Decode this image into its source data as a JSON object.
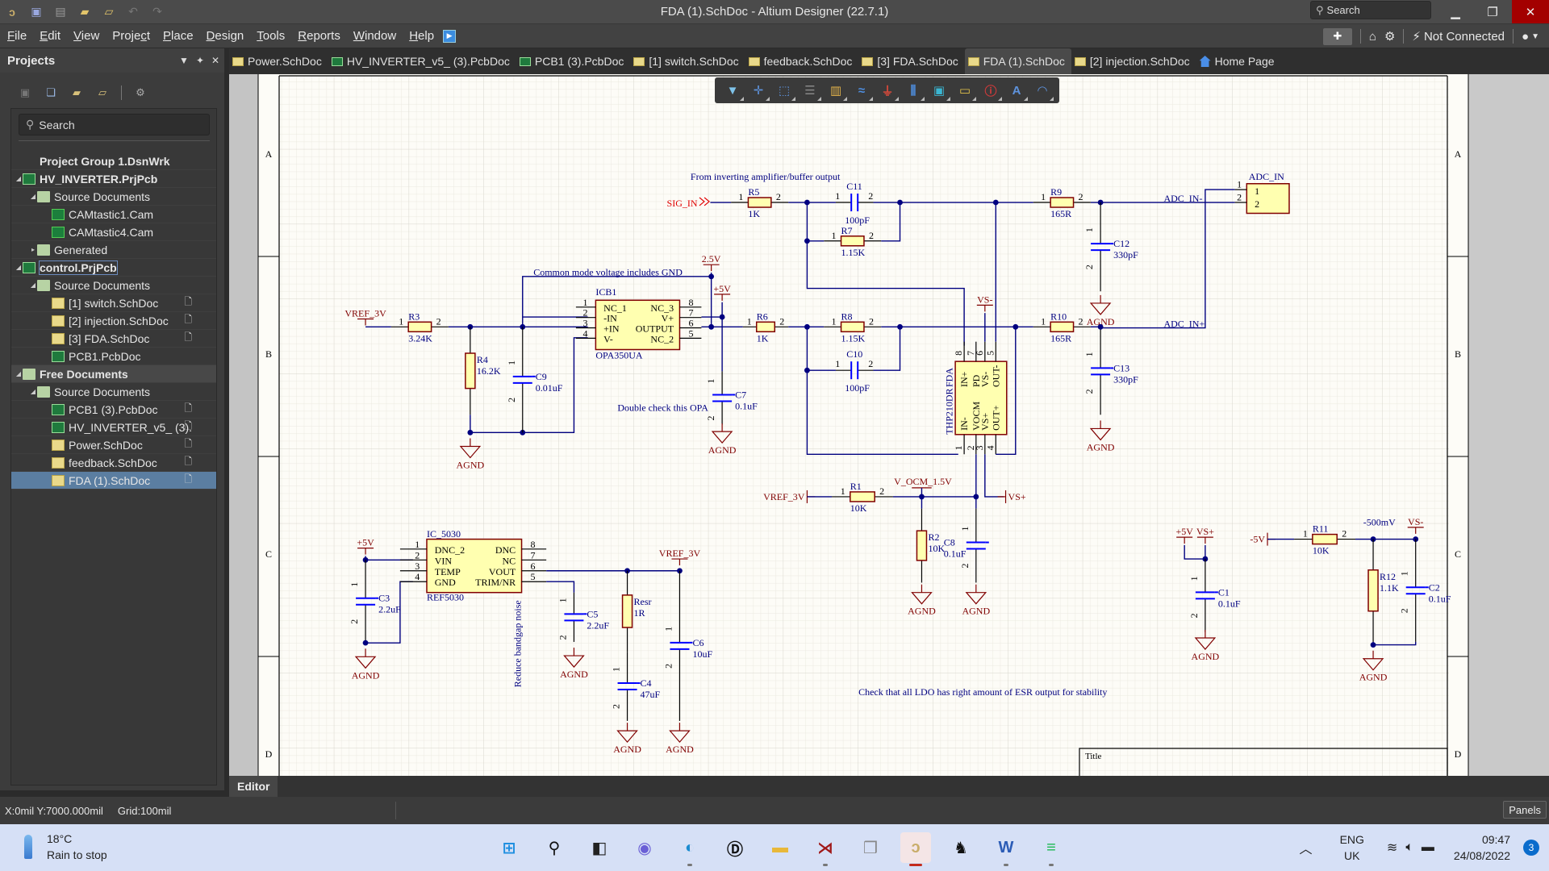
{
  "window": {
    "title": "FDA (1).SchDoc - Altium Designer (22.7.1)",
    "search_placeholder": "Search",
    "minimize_icon": "minimize-icon",
    "maximize_icon": "restore-icon",
    "close_icon": "close-icon"
  },
  "quick_access": [
    "app-logo-icon",
    "save-icon",
    "print-icon",
    "open-icon",
    "open-project-icon",
    "undo-icon",
    "redo-icon"
  ],
  "menu": {
    "items": [
      {
        "label": "File",
        "u": "F"
      },
      {
        "label": "Edit",
        "u": "E"
      },
      {
        "label": "View",
        "u": "V"
      },
      {
        "label": "Project",
        "u": "c"
      },
      {
        "label": "Place",
        "u": "P"
      },
      {
        "label": "Design",
        "u": "D"
      },
      {
        "label": "Tools",
        "u": "T"
      },
      {
        "label": "Reports",
        "u": "R"
      },
      {
        "label": "Window",
        "u": "W"
      },
      {
        "label": "Help",
        "u": "H"
      }
    ],
    "connection_status": "Not Connected"
  },
  "projects_panel": {
    "title": "Projects",
    "search_placeholder": "Search",
    "tree": [
      {
        "label": "Project Group 1.DsnWrk",
        "level": 0,
        "icon": "group",
        "bold": true,
        "arrow": ""
      },
      {
        "label": "HV_INVERTER.PrjPcb",
        "level": 0,
        "icon": "pcb",
        "bold": true,
        "arrow": "down"
      },
      {
        "label": "Source Documents",
        "level": 1,
        "icon": "folder",
        "arrow": "down"
      },
      {
        "label": "CAMtastic1.Cam",
        "level": 2,
        "icon": "cam"
      },
      {
        "label": "CAMtastic4.Cam",
        "level": 2,
        "icon": "cam"
      },
      {
        "label": "Generated",
        "level": 1,
        "icon": "folder",
        "arrow": "right"
      },
      {
        "label": "control.PrjPcb",
        "level": 0,
        "icon": "pcb",
        "bold": true,
        "arrow": "down",
        "focused": true
      },
      {
        "label": "Source Documents",
        "level": 1,
        "icon": "folder",
        "arrow": "down"
      },
      {
        "label": "[1] switch.SchDoc",
        "level": 2,
        "icon": "sch",
        "doc": true
      },
      {
        "label": "[2] injection.SchDoc",
        "level": 2,
        "icon": "sch",
        "doc": true
      },
      {
        "label": "[3] FDA.SchDoc",
        "level": 2,
        "icon": "sch",
        "doc": true
      },
      {
        "label": "PCB1.PcbDoc",
        "level": 2,
        "icon": "pcb"
      },
      {
        "label": "Free Documents",
        "level": 0,
        "icon": "folder",
        "bold": true,
        "arrow": "down",
        "section": true
      },
      {
        "label": "Source Documents",
        "level": 1,
        "icon": "folder",
        "arrow": "down"
      },
      {
        "label": "PCB1 (3).PcbDoc",
        "level": 2,
        "icon": "pcb",
        "doc": true
      },
      {
        "label": "HV_INVERTER_v5_ (3).",
        "level": 2,
        "icon": "pcb",
        "doc": true
      },
      {
        "label": "Power.SchDoc",
        "level": 2,
        "icon": "sch",
        "doc": true
      },
      {
        "label": "feedback.SchDoc",
        "level": 2,
        "icon": "sch",
        "doc": true
      },
      {
        "label": "FDA (1).SchDoc",
        "level": 2,
        "icon": "sch",
        "doc": true,
        "selected": true
      }
    ]
  },
  "doc_tabs": [
    {
      "label": "Power.SchDoc",
      "icon": "sch"
    },
    {
      "label": "HV_INVERTER_v5_ (3).PcbDoc",
      "icon": "pcb"
    },
    {
      "label": "PCB1 (3).PcbDoc",
      "icon": "pcb"
    },
    {
      "label": "[1] switch.SchDoc",
      "icon": "sch"
    },
    {
      "label": "feedback.SchDoc",
      "icon": "sch"
    },
    {
      "label": "[3] FDA.SchDoc",
      "icon": "sch"
    },
    {
      "label": "FDA (1).SchDoc",
      "icon": "sch",
      "active": true
    },
    {
      "label": "[2] injection.SchDoc",
      "icon": "sch"
    },
    {
      "label": "Home Page",
      "icon": "home"
    }
  ],
  "place_toolbar": [
    "filter-icon",
    "crosshair-icon",
    "select-rect-icon",
    "align-icon",
    "part-icon",
    "bus-icon",
    "gnd-power-icon",
    "harness-icon",
    "sheet-symbol-icon",
    "port-icon",
    "no-erc-icon",
    "text-icon",
    "arc-icon"
  ],
  "sheet": {
    "zone_labels": [
      "A",
      "B",
      "C",
      "D"
    ],
    "title_block_label": "Title",
    "notes": {
      "from_inverting": "From inverting amplifier/buffer output",
      "common_mode": "Common mode voltage includes GND",
      "double_check": "Double check this OPA",
      "reduce_noise": "Reduce bandgap noise",
      "ldo_check": "Check that all LDO has right amount of ESR output for stability"
    },
    "nets": {
      "sig_in": "SIG_IN",
      "vref_3v": "VREF_3V",
      "v_2_5": "2.5V",
      "p5v": "+5V",
      "vs_minus": "VS-",
      "vs_plus": "VS+",
      "agnd": "AGND",
      "v_ocm": "V_OCM_1.5V",
      "adc_in_minus": "ADC_IN-",
      "adc_in_plus": "ADC_IN+",
      "m5v": "-5V",
      "m500mv": "-500mV"
    },
    "components": {
      "R1": {
        "des": "R1",
        "val": "10K"
      },
      "R2": {
        "des": "R2",
        "val": "10K"
      },
      "R3": {
        "des": "R3",
        "val": "3.24K"
      },
      "R4": {
        "des": "R4",
        "val": "16.2K"
      },
      "R5": {
        "des": "R5",
        "val": "1K"
      },
      "R6": {
        "des": "R6",
        "val": "1K"
      },
      "R7": {
        "des": "R7",
        "val": "1.15K"
      },
      "R8": {
        "des": "R8",
        "val": "1.15K"
      },
      "R9": {
        "des": "R9",
        "val": "165R"
      },
      "R10": {
        "des": "R10",
        "val": "165R"
      },
      "R11": {
        "des": "R11",
        "val": "10K"
      },
      "R12": {
        "des": "R12",
        "val": "1.1K"
      },
      "Resr": {
        "des": "Resr",
        "val": "1R"
      },
      "C1": {
        "des": "C1",
        "val": "0.1uF"
      },
      "C2": {
        "des": "C2",
        "val": "0.1uF"
      },
      "C3": {
        "des": "C3",
        "val": "2.2uF"
      },
      "C4": {
        "des": "C4",
        "val": "47uF"
      },
      "C5": {
        "des": "C5",
        "val": "2.2uF"
      },
      "C6": {
        "des": "C6",
        "val": "10uF"
      },
      "C7": {
        "des": "C7",
        "val": "0.1uF"
      },
      "C8": {
        "des": "C8",
        "val": "0.1uF"
      },
      "C9": {
        "des": "C9",
        "val": "0.01uF"
      },
      "C10": {
        "des": "C10",
        "val": "100pF"
      },
      "C11": {
        "des": "C11",
        "val": "100pF"
      },
      "C12": {
        "des": "C12",
        "val": "330pF"
      },
      "C13": {
        "des": "C13",
        "val": "330pF"
      }
    },
    "ics": {
      "ICB1": {
        "des": "ICB1",
        "part": "OPA350UA",
        "left_pins": [
          {
            "n": "1",
            "name": "NC_1"
          },
          {
            "n": "2",
            "name": "-IN"
          },
          {
            "n": "3",
            "name": "+IN"
          },
          {
            "n": "4",
            "name": "V-"
          }
        ],
        "right_pins": [
          {
            "n": "8",
            "name": "NC_3"
          },
          {
            "n": "7",
            "name": "V+"
          },
          {
            "n": "6",
            "name": "OUTPUT"
          },
          {
            "n": "5",
            "name": "NC_2"
          }
        ]
      },
      "IC_5030": {
        "des": "IC_5030",
        "part": "REF5030",
        "left_pins": [
          {
            "n": "1",
            "name": "DNC_2"
          },
          {
            "n": "2",
            "name": "VIN"
          },
          {
            "n": "3",
            "name": "TEMP"
          },
          {
            "n": "4",
            "name": "GND"
          }
        ],
        "right_pins": [
          {
            "n": "8",
            "name": "DNC"
          },
          {
            "n": "7",
            "name": "NC"
          },
          {
            "n": "6",
            "name": "VOUT"
          },
          {
            "n": "5",
            "name": "TRIM/NR"
          }
        ]
      },
      "FDA": {
        "des": "FDA",
        "part": "THP210DR",
        "top_pins": [
          {
            "n": "8",
            "name": "IN+"
          },
          {
            "n": "7",
            "name": "PD"
          },
          {
            "n": "6",
            "name": "VS-"
          },
          {
            "n": "5",
            "name": "OUT-"
          }
        ],
        "bottom_pins": [
          {
            "n": "1",
            "name": "IN-"
          },
          {
            "n": "2",
            "name": "VOCM"
          },
          {
            "n": "3",
            "name": "VS+"
          },
          {
            "n": "4",
            "name": "OUT+"
          }
        ]
      },
      "ADC_IN": {
        "des": "ADC_IN",
        "pins": [
          {
            "n": "1"
          },
          {
            "n": "2"
          }
        ]
      }
    }
  },
  "editor_tab": "Editor",
  "status": {
    "coords": "X:0mil Y:7000.000mil",
    "grid": "Grid:100mil",
    "panels_button": "Panels"
  },
  "taskbar": {
    "weather_temp": "18°C",
    "weather_desc": "Rain to stop",
    "apps": [
      "start-icon",
      "search-icon",
      "task-view-icon",
      "teams-chat-icon",
      "edge-icon",
      "dell-icon",
      "file-explorer-icon",
      "ltspice-icon",
      "3d-viewer-icon",
      "altium-icon",
      "ti-icon",
      "word-icon",
      "spotify-icon"
    ],
    "active_app": "altium-icon",
    "lang_1": "ENG",
    "lang_2": "UK",
    "time": "09:47",
    "date": "24/08/2022",
    "notifications": "3"
  }
}
